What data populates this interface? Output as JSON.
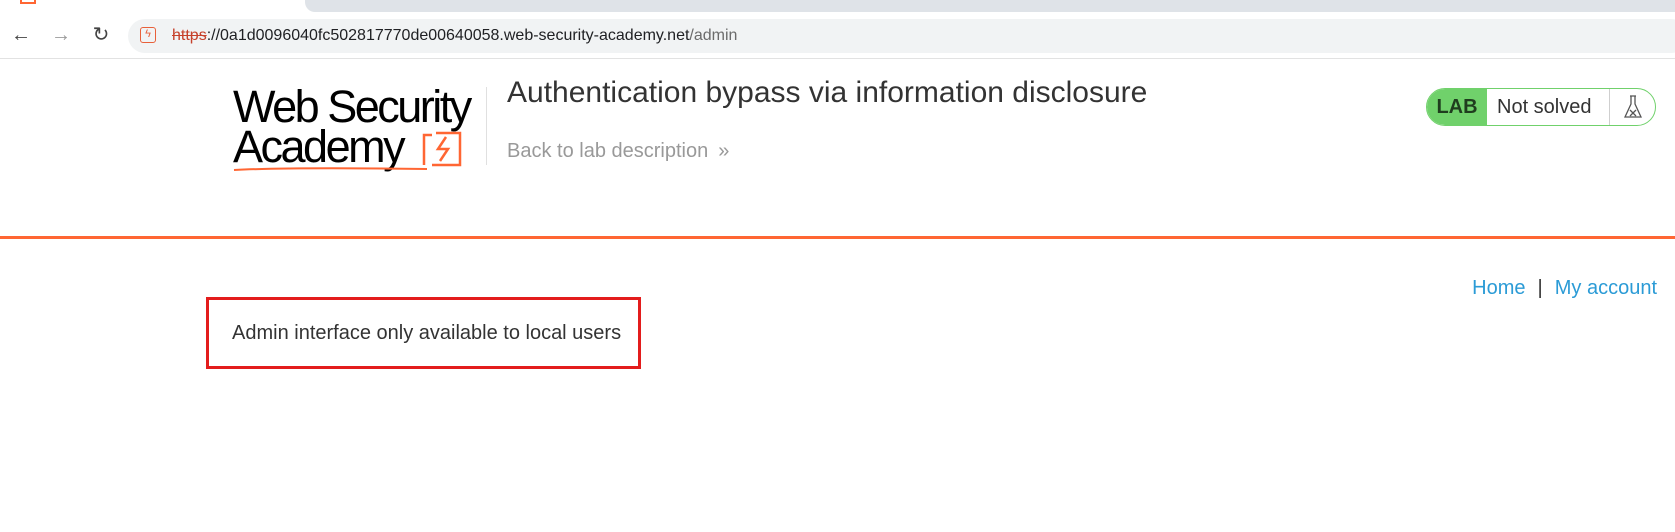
{
  "browser": {
    "url_scheme": "https",
    "url_host": "://0a1d0096040fc502817770de00640058.web-security-academy.net",
    "url_path": "/admin",
    "site_icon": "lightning-icon",
    "nav": {
      "back_icon": "←",
      "forward_icon": "→",
      "reload_icon": "↻"
    }
  },
  "logo": {
    "line1": "Web Security",
    "line2": "Academy"
  },
  "header": {
    "title": "Authentication bypass via information disclosure",
    "back_link": "Back to lab description",
    "back_chevron": "»"
  },
  "status": {
    "tag": "LAB",
    "text": "Not solved",
    "icon": "flask-icon"
  },
  "nav_links": {
    "home": "Home",
    "separator": "|",
    "account": "My account"
  },
  "main": {
    "message": "Admin interface only available to local users"
  },
  "colors": {
    "accent_orange": "#ff6633",
    "lab_green": "#70d16b",
    "link_blue": "#2b9bd6",
    "highlight_red": "#e31c1c"
  }
}
